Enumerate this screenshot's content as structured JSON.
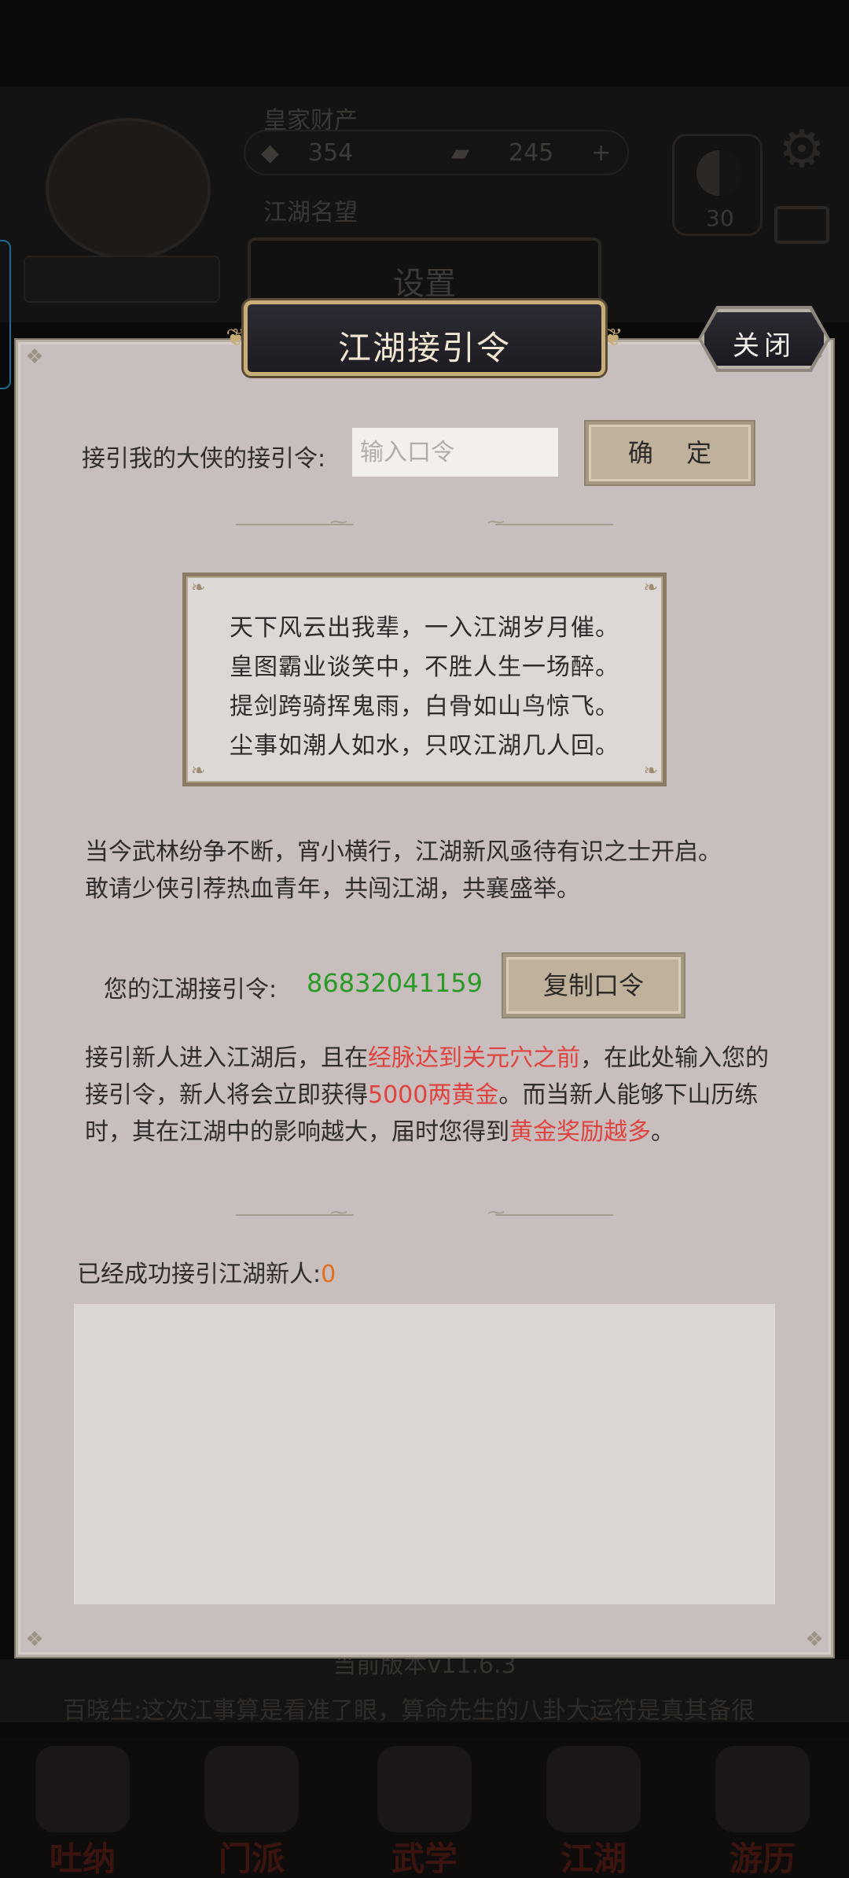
{
  "background": {
    "wealth_label": "皇家财产",
    "gold": "354",
    "jade": "245",
    "reputation_label": "江湖名望",
    "yinyang_value": "30",
    "settings_header": "设置",
    "version": "当前版本v11.6.3",
    "news": "百晓生:这次江事算是看准了眼，算命先生的八卦大运符是真其备很",
    "nav": [
      "吐纳",
      "门派",
      "武学",
      "江湖",
      "游历"
    ]
  },
  "dialog": {
    "title": "江湖接引令",
    "close_label": "关闭",
    "invite_label": "接引我的大侠的接引令:",
    "invite_placeholder": "输入口令",
    "confirm_label": "确 定",
    "poem": [
      "天下风云出我辈，一入江湖岁月催。",
      "皇图霸业谈笑中，不胜人生一场醉。",
      "提剑跨骑挥鬼雨，白骨如山鸟惊飞。",
      "尘事如潮人如水，只叹江湖几人回。"
    ],
    "intro": [
      "当今武林纷争不断，宵小横行，江湖新风亟待有识之士开启。",
      "敢请少侠引荐热血青年，共闯江湖，共襄盛举。"
    ],
    "my_code_label": "您的江湖接引令:",
    "my_code": "86832041159",
    "copy_label": "复制口令",
    "rules": {
      "p1": "接引新人进入江湖后，且在",
      "h1": "经脉达到关元穴之前",
      "p2": "，在此处输入您的接引令，新人将会立即获得",
      "h2": "5000两黄金",
      "p3": "。而当新人能够下山历练时，其在江湖中的影响越大，届时您得到",
      "h3": "黄金奖励越多",
      "p4": "。"
    },
    "success_label": "已经成功接引江湖新人:",
    "success_count": "0"
  },
  "colors": {
    "dialog_bg": "#c7bebd",
    "highlight_red": "#e0433f",
    "code_green": "#2a9a26",
    "count_orange": "#e0701e"
  }
}
